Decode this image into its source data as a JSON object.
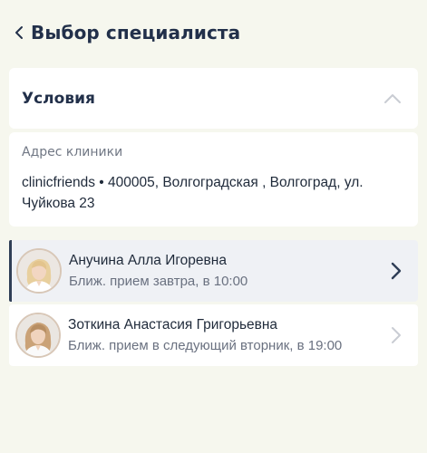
{
  "header": {
    "title": "Выбор специалиста",
    "back_icon": "chevron-left-icon"
  },
  "conditions": {
    "title": "Условия",
    "expanded": true,
    "toggle_icon": "chevron-up-icon"
  },
  "address": {
    "label": "Адрес клиники",
    "value": "clinicfriends • 400005, Волгоградская , Волгоград, ул. Чуйкова 23"
  },
  "specialists": [
    {
      "name": "Анучина Алла Игоревна",
      "next_appointment": "Ближ. прием завтра, в 10:00",
      "selected": true,
      "avatar_icon": "doctor-photo"
    },
    {
      "name": "Зоткина Анастасия Григорьевна",
      "next_appointment": "Ближ. прием в следующий вторник, в 19:00",
      "selected": false,
      "avatar_icon": "doctor-photo"
    }
  ],
  "colors": {
    "background": "#f6f7ee",
    "card": "#ffffff",
    "selected_row": "#eff1f5",
    "accent": "#2f3e56",
    "muted_chevron": "#c9ccd3"
  }
}
